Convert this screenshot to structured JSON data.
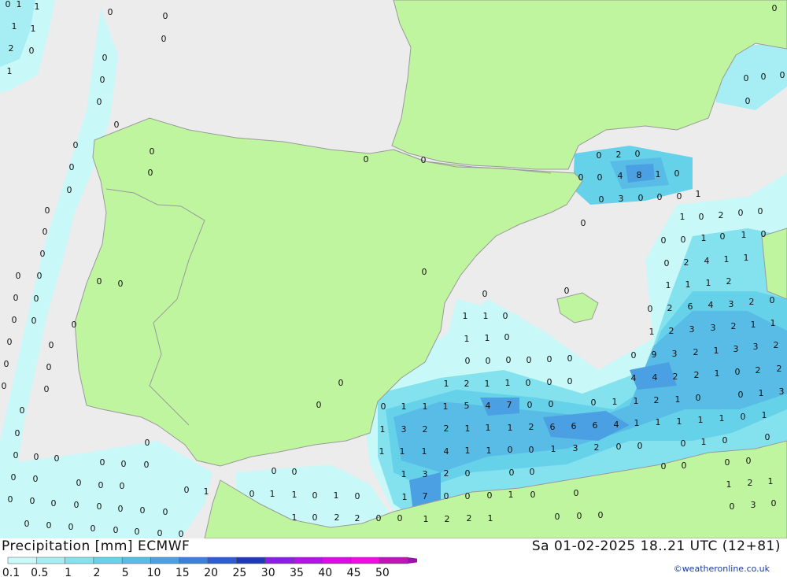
{
  "title_left": "Precipitation [mm] ECMWF",
  "title_right": "Sa 01-02-2025 18..21 UTC (12+81)",
  "credit": "©weatheronline.co.uk",
  "legend": {
    "labels": [
      "0.1",
      "0.5",
      "1",
      "2",
      "5",
      "10",
      "15",
      "20",
      "25",
      "30",
      "35",
      "40",
      "45",
      "50"
    ],
    "colors": [
      "#c8f8f8",
      "#a6eef4",
      "#84e2ee",
      "#66d2ea",
      "#58bce6",
      "#4aa0e2",
      "#3c80dc",
      "#2e5cd2",
      "#1e3ab8",
      "#8a1ee6",
      "#b214e6",
      "#dc0ce6",
      "#f00ce0",
      "#c014b8"
    ]
  },
  "colors": {
    "sea": "#ececec",
    "land": "#bff59f",
    "border": "#9a9a9a"
  },
  "map_values": [
    [
      "0",
      10,
      5
    ],
    [
      "1",
      24,
      5
    ],
    [
      "1",
      47,
      8
    ],
    [
      "1",
      18,
      33
    ],
    [
      "1",
      42,
      36
    ],
    [
      "2",
      14,
      61
    ],
    [
      "0",
      40,
      64
    ],
    [
      "1",
      12,
      90
    ],
    [
      "0",
      140,
      15
    ],
    [
      "0",
      210,
      20
    ],
    [
      "0",
      208,
      49
    ],
    [
      "0",
      133,
      73
    ],
    [
      "0",
      130,
      101
    ],
    [
      "0",
      126,
      129
    ],
    [
      "0",
      148,
      158
    ],
    [
      "0",
      96,
      184
    ],
    [
      "0",
      193,
      192
    ],
    [
      "0",
      91,
      212
    ],
    [
      "0",
      191,
      219
    ],
    [
      "0",
      88,
      241
    ],
    [
      "0",
      60,
      267
    ],
    [
      "0",
      57,
      294
    ],
    [
      "0",
      54,
      322
    ],
    [
      "0",
      23,
      350
    ],
    [
      "0",
      50,
      350
    ],
    [
      "0",
      126,
      357
    ],
    [
      "0",
      153,
      360
    ],
    [
      "0",
      20,
      378
    ],
    [
      "0",
      46,
      379
    ],
    [
      "0",
      18,
      406
    ],
    [
      "0",
      43,
      407
    ],
    [
      "0",
      94,
      412
    ],
    [
      "0",
      12,
      434
    ],
    [
      "0",
      65,
      438
    ],
    [
      "0",
      8,
      462
    ],
    [
      "0",
      62,
      466
    ],
    [
      "0",
      5,
      490
    ],
    [
      "0",
      59,
      494
    ],
    [
      "0",
      28,
      521
    ],
    [
      "0",
      22,
      550
    ],
    [
      "0",
      20,
      578
    ],
    [
      "0",
      46,
      580
    ],
    [
      "0",
      72,
      582
    ],
    [
      "0",
      187,
      562
    ],
    [
      "0",
      130,
      587
    ],
    [
      "0",
      157,
      589
    ],
    [
      "0",
      186,
      590
    ],
    [
      "0",
      17,
      606
    ],
    [
      "0",
      45,
      608
    ],
    [
      "0",
      100,
      613
    ],
    [
      "0",
      128,
      616
    ],
    [
      "0",
      155,
      617
    ],
    [
      "0",
      13,
      634
    ],
    [
      "0",
      41,
      636
    ],
    [
      "0",
      68,
      639
    ],
    [
      "0",
      97,
      641
    ],
    [
      "0",
      126,
      643
    ],
    [
      "0",
      153,
      646
    ],
    [
      "0",
      181,
      648
    ],
    [
      "0",
      210,
      650
    ],
    [
      "0",
      237,
      622
    ],
    [
      "1",
      262,
      624
    ],
    [
      "0",
      34,
      665
    ],
    [
      "0",
      62,
      667
    ],
    [
      "0",
      90,
      669
    ],
    [
      "0",
      118,
      671
    ],
    [
      "0",
      147,
      673
    ],
    [
      "0",
      174,
      675
    ],
    [
      "0",
      203,
      677
    ],
    [
      "0",
      230,
      678
    ],
    [
      "0",
      348,
      598
    ],
    [
      "0",
      374,
      599
    ],
    [
      "0",
      320,
      627
    ],
    [
      "1",
      346,
      627
    ],
    [
      "1",
      374,
      628
    ],
    [
      "0",
      400,
      629
    ],
    [
      "1",
      427,
      629
    ],
    [
      "0",
      454,
      630
    ],
    [
      "1",
      374,
      657
    ],
    [
      "0",
      400,
      657
    ],
    [
      "2",
      428,
      657
    ],
    [
      "2",
      454,
      658
    ],
    [
      "0",
      481,
      658
    ],
    [
      "0",
      508,
      658
    ],
    [
      "0",
      465,
      202
    ],
    [
      "0",
      538,
      203
    ],
    [
      "0",
      539,
      345
    ],
    [
      "0",
      433,
      486
    ],
    [
      "0",
      405,
      514
    ],
    [
      "0",
      761,
      197
    ],
    [
      "2",
      786,
      196
    ],
    [
      "0",
      810,
      195
    ],
    [
      "0",
      738,
      225
    ],
    [
      "0",
      762,
      225
    ],
    [
      "4",
      788,
      223
    ],
    [
      "8",
      812,
      222
    ],
    [
      "1",
      836,
      221
    ],
    [
      "0",
      860,
      220
    ],
    [
      "0",
      764,
      253
    ],
    [
      "3",
      789,
      252
    ],
    [
      "0",
      814,
      251
    ],
    [
      "0",
      838,
      250
    ],
    [
      "0",
      863,
      249
    ],
    [
      "1",
      887,
      246
    ],
    [
      "0",
      741,
      283
    ],
    [
      "1",
      867,
      275
    ],
    [
      "0",
      891,
      275
    ],
    [
      "2",
      916,
      273
    ],
    [
      "0",
      941,
      270
    ],
    [
      "0",
      966,
      268
    ],
    [
      "0",
      843,
      305
    ],
    [
      "0",
      868,
      304
    ],
    [
      "1",
      894,
      302
    ],
    [
      "0",
      918,
      300
    ],
    [
      "1",
      945,
      298
    ],
    [
      "0",
      970,
      297
    ],
    [
      "0",
      847,
      334
    ],
    [
      "2",
      872,
      333
    ],
    [
      "4",
      898,
      331
    ],
    [
      "1",
      923,
      329
    ],
    [
      "1",
      948,
      327
    ],
    [
      "0",
      720,
      369
    ],
    [
      "1",
      849,
      362
    ],
    [
      "1",
      874,
      361
    ],
    [
      "1",
      900,
      359
    ],
    [
      "2",
      926,
      357
    ],
    [
      "0",
      616,
      373
    ],
    [
      "0",
      826,
      392
    ],
    [
      "2",
      851,
      391
    ],
    [
      "6",
      877,
      389
    ],
    [
      "4",
      903,
      387
    ],
    [
      "3",
      929,
      386
    ],
    [
      "2",
      955,
      383
    ],
    [
      "0",
      981,
      381
    ],
    [
      "1",
      591,
      401
    ],
    [
      "1",
      617,
      401
    ],
    [
      "0",
      642,
      401
    ],
    [
      "1",
      828,
      421
    ],
    [
      "2",
      853,
      420
    ],
    [
      "3",
      879,
      418
    ],
    [
      "3",
      906,
      416
    ],
    [
      "2",
      932,
      414
    ],
    [
      "1",
      957,
      412
    ],
    [
      "1",
      982,
      410
    ],
    [
      "1",
      593,
      430
    ],
    [
      "1",
      619,
      429
    ],
    [
      "0",
      644,
      428
    ],
    [
      "0",
      805,
      451
    ],
    [
      "9",
      831,
      450
    ],
    [
      "3",
      857,
      449
    ],
    [
      "2",
      884,
      447
    ],
    [
      "1",
      910,
      445
    ],
    [
      "3",
      935,
      443
    ],
    [
      "3",
      960,
      440
    ],
    [
      "2",
      986,
      438
    ],
    [
      "0",
      594,
      458
    ],
    [
      "0",
      620,
      458
    ],
    [
      "0",
      646,
      457
    ],
    [
      "0",
      672,
      457
    ],
    [
      "0",
      698,
      456
    ],
    [
      "0",
      724,
      455
    ],
    [
      "1",
      567,
      487
    ],
    [
      "2",
      593,
      487
    ],
    [
      "1",
      619,
      487
    ],
    [
      "1",
      645,
      486
    ],
    [
      "0",
      671,
      486
    ],
    [
      "0",
      698,
      485
    ],
    [
      "0",
      724,
      484
    ],
    [
      "4",
      805,
      480
    ],
    [
      "4",
      832,
      479
    ],
    [
      "2",
      858,
      478
    ],
    [
      "2",
      885,
      476
    ],
    [
      "1",
      911,
      474
    ],
    [
      "0",
      937,
      472
    ],
    [
      "2",
      963,
      470
    ],
    [
      "2",
      990,
      468
    ],
    [
      "0",
      487,
      516
    ],
    [
      "1",
      513,
      516
    ],
    [
      "1",
      540,
      516
    ],
    [
      "1",
      566,
      516
    ],
    [
      "5",
      593,
      515
    ],
    [
      "4",
      620,
      515
    ],
    [
      "7",
      647,
      514
    ],
    [
      "0",
      673,
      514
    ],
    [
      "0",
      700,
      513
    ],
    [
      "0",
      754,
      511
    ],
    [
      "1",
      781,
      510
    ],
    [
      "1",
      808,
      509
    ],
    [
      "2",
      834,
      508
    ],
    [
      "1",
      861,
      507
    ],
    [
      "0",
      887,
      505
    ],
    [
      "0",
      941,
      501
    ],
    [
      "1",
      967,
      499
    ],
    [
      "3",
      993,
      497
    ],
    [
      "1",
      486,
      545
    ],
    [
      "3",
      513,
      545
    ],
    [
      "2",
      540,
      545
    ],
    [
      "2",
      567,
      544
    ],
    [
      "1",
      594,
      544
    ],
    [
      "1",
      620,
      543
    ],
    [
      "1",
      648,
      543
    ],
    [
      "2",
      675,
      542
    ],
    [
      "6",
      702,
      542
    ],
    [
      "6",
      729,
      541
    ],
    [
      "6",
      756,
      540
    ],
    [
      "4",
      783,
      539
    ],
    [
      "1",
      809,
      537
    ],
    [
      "1",
      836,
      536
    ],
    [
      "1",
      863,
      535
    ],
    [
      "1",
      890,
      533
    ],
    [
      "1",
      917,
      531
    ],
    [
      "0",
      944,
      529
    ],
    [
      "1",
      971,
      527
    ],
    [
      "1",
      485,
      573
    ],
    [
      "1",
      511,
      573
    ],
    [
      "1",
      539,
      573
    ],
    [
      "4",
      567,
      573
    ],
    [
      "1",
      594,
      572
    ],
    [
      "1",
      621,
      572
    ],
    [
      "0",
      648,
      571
    ],
    [
      "0",
      675,
      571
    ],
    [
      "1",
      703,
      570
    ],
    [
      "3",
      731,
      569
    ],
    [
      "2",
      758,
      568
    ],
    [
      "0",
      786,
      567
    ],
    [
      "0",
      813,
      566
    ],
    [
      "0",
      868,
      563
    ],
    [
      "1",
      894,
      561
    ],
    [
      "0",
      921,
      559
    ],
    [
      "0",
      975,
      555
    ],
    [
      "1",
      513,
      602
    ],
    [
      "3",
      540,
      602
    ],
    [
      "2",
      567,
      601
    ],
    [
      "0",
      594,
      601
    ],
    [
      "0",
      650,
      600
    ],
    [
      "0",
      676,
      599
    ],
    [
      "0",
      843,
      592
    ],
    [
      "0",
      869,
      591
    ],
    [
      "0",
      924,
      587
    ],
    [
      "0",
      951,
      585
    ],
    [
      "1",
      514,
      631
    ],
    [
      "7",
      540,
      630
    ],
    [
      "0",
      567,
      630
    ],
    [
      "0",
      594,
      630
    ],
    [
      "0",
      622,
      629
    ],
    [
      "1",
      649,
      628
    ],
    [
      "0",
      677,
      628
    ],
    [
      "0",
      732,
      626
    ],
    [
      "1",
      926,
      615
    ],
    [
      "2",
      953,
      613
    ],
    [
      "1",
      979,
      611
    ],
    [
      "1",
      541,
      659
    ],
    [
      "2",
      568,
      659
    ],
    [
      "2",
      596,
      658
    ],
    [
      "1",
      623,
      658
    ],
    [
      "0",
      708,
      656
    ],
    [
      "0",
      736,
      655
    ],
    [
      "0",
      763,
      654
    ],
    [
      "0",
      930,
      643
    ],
    [
      "3",
      957,
      641
    ],
    [
      "0",
      983,
      639
    ],
    [
      "0",
      948,
      99
    ],
    [
      "0",
      970,
      97
    ],
    [
      "0",
      994,
      95
    ],
    [
      "0",
      950,
      128
    ],
    [
      "0",
      984,
      10
    ]
  ]
}
